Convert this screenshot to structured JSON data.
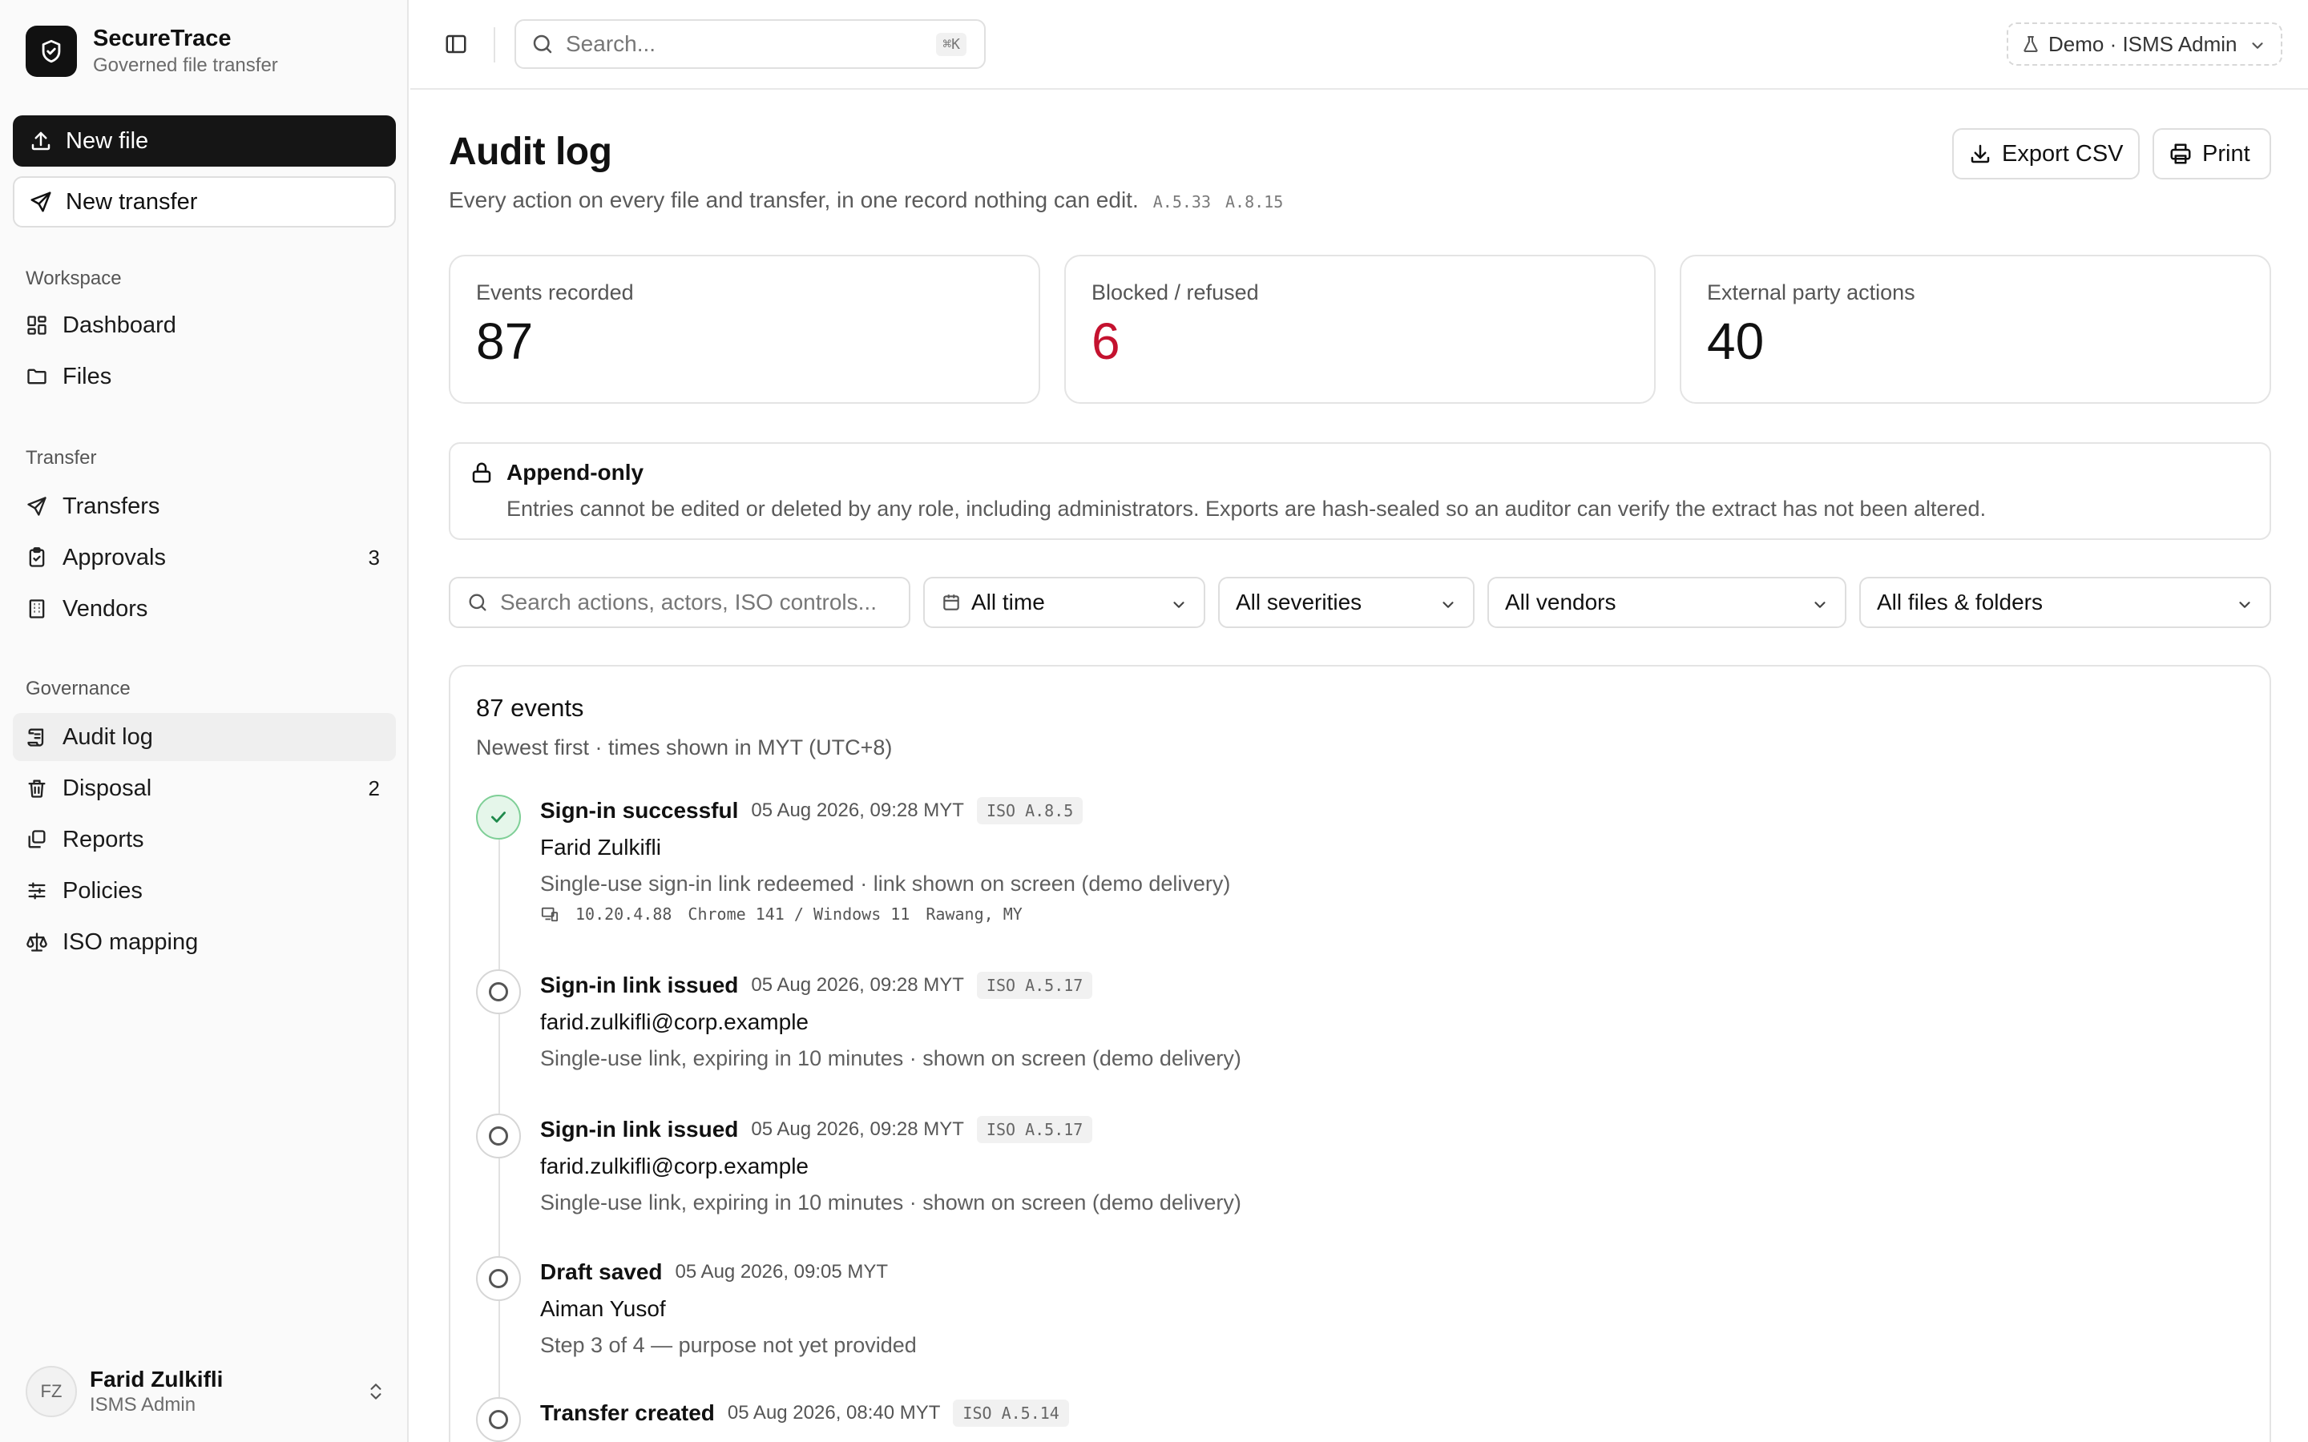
{
  "brand": {
    "name": "SecureTrace",
    "tagline": "Governed file transfer"
  },
  "actions": {
    "new_file": "New file",
    "new_transfer": "New transfer"
  },
  "nav": {
    "workspace": {
      "heading": "Workspace",
      "dashboard": "Dashboard",
      "files": "Files"
    },
    "transfer": {
      "heading": "Transfer",
      "transfers": "Transfers",
      "approvals": "Approvals",
      "approvals_count": "3",
      "vendors": "Vendors"
    },
    "governance": {
      "heading": "Governance",
      "audit_log": "Audit log",
      "disposal": "Disposal",
      "disposal_count": "2",
      "reports": "Reports",
      "policies": "Policies",
      "iso_mapping": "ISO mapping"
    }
  },
  "user": {
    "initials": "FZ",
    "name": "Farid Zulkifli",
    "role": "ISMS Admin"
  },
  "topbar": {
    "search_placeholder": "Search...",
    "shortcut": "⌘K",
    "role_switch": "Demo · ISMS Admin"
  },
  "page": {
    "title": "Audit log",
    "subtitle": "Every action on every file and transfer, in one record nothing can edit.",
    "iso_refs": [
      "A.5.33",
      "A.8.15"
    ],
    "export_label": "Export CSV",
    "print_label": "Print"
  },
  "stats": [
    {
      "label": "Events recorded",
      "value": "87"
    },
    {
      "label": "Blocked / refused",
      "value": "6"
    },
    {
      "label": "External party actions",
      "value": "40"
    }
  ],
  "notice": {
    "title": "Append-only",
    "body": "Entries cannot be edited or deleted by any role, including administrators. Exports are hash-sealed so an auditor can verify the extract has not been altered."
  },
  "filters": {
    "search_placeholder": "Search actions, actors, ISO controls...",
    "time": "All time",
    "severity": "All severities",
    "vendor": "All vendors",
    "scope": "All files & folders"
  },
  "events": {
    "title": "87 events",
    "subtitle": "Newest first · times shown in MYT (UTC+8)",
    "items": [
      {
        "title": "Sign-in successful",
        "time": "05 Aug 2026, 09:28 MYT",
        "iso": "ISO A.8.5",
        "actor": "Farid Zulkifli",
        "desc": "Single-use sign-in link redeemed · link shown on screen (demo delivery)",
        "ip": "10.20.4.88",
        "agent": "Chrome 141 / Windows 11",
        "location": "Rawang, MY"
      },
      {
        "title": "Sign-in link issued",
        "time": "05 Aug 2026, 09:28 MYT",
        "iso": "ISO A.5.17",
        "actor": "farid.zulkifli@corp.example",
        "desc": "Single-use link, expiring in 10 minutes · shown on screen (demo delivery)"
      },
      {
        "title": "Sign-in link issued",
        "time": "05 Aug 2026, 09:28 MYT",
        "iso": "ISO A.5.17",
        "actor": "farid.zulkifli@corp.example",
        "desc": "Single-use link, expiring in 10 minutes · shown on screen (demo delivery)"
      },
      {
        "title": "Draft saved",
        "time": "05 Aug 2026, 09:05 MYT",
        "actor": "Aiman Yusof",
        "desc": "Step 3 of 4 — purpose not yet provided"
      },
      {
        "title": "Transfer created",
        "time": "05 Aug 2026, 08:40 MYT",
        "iso": "ISO A.5.14"
      }
    ]
  },
  "colors": {
    "accent_dark": "#151515",
    "danger": "#c4122f",
    "success_bg": "#e5f6ea",
    "success": "#1f8a4c"
  }
}
